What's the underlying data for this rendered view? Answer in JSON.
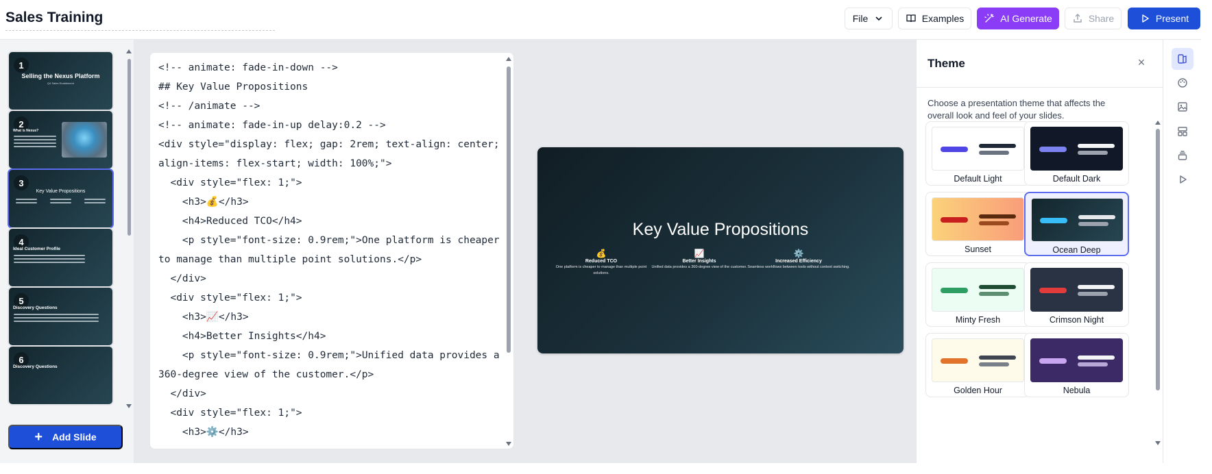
{
  "header": {
    "title": "Sales Training",
    "file_label": "File",
    "examples_label": "Examples",
    "ai_label": "AI Generate",
    "share_label": "Share",
    "present_label": "Present"
  },
  "sidebar": {
    "add_slide_label": "Add Slide",
    "slides": [
      {
        "num": "1",
        "title": "Selling the Nexus Platform",
        "subtitle": "Q4 Sales Enablement"
      },
      {
        "num": "2",
        "title": "What is Nexus?"
      },
      {
        "num": "3",
        "title": "Key Value Propositions"
      },
      {
        "num": "4",
        "title": "Ideal Customer Profile"
      },
      {
        "num": "5",
        "title": "Discovery Questions"
      },
      {
        "num": "6",
        "title": "Discovery Questions"
      }
    ]
  },
  "editor": {
    "code": "<!-- animate: fade-in-down -->\n## Key Value Propositions\n<!-- /animate -->\n<!-- animate: fade-in-up delay:0.2 -->\n<div style=\"display: flex; gap: 2rem; text-align: center; align-items: flex-start; width: 100%;\">\n  <div style=\"flex: 1;\">\n    <h3>💰</h3>\n    <h4>Reduced TCO</h4>\n    <p style=\"font-size: 0.9rem;\">One platform is cheaper to manage than multiple point solutions.</p>\n  </div>\n  <div style=\"flex: 1;\">\n    <h3>📈</h3>\n    <h4>Better Insights</h4>\n    <p style=\"font-size: 0.9rem;\">Unified data provides a 360-degree view of the customer.</p>\n  </div>\n  <div style=\"flex: 1;\">\n    <h3>⚙️</h3>"
  },
  "preview": {
    "title": "Key Value Propositions",
    "columns": [
      {
        "icon": "💰",
        "heading": "Reduced TCO",
        "text": "One platform is cheaper to manage than multiple point solutions."
      },
      {
        "icon": "📈",
        "heading": "Better Insights",
        "text": "Unified data provides a 360-degree view of the customer."
      },
      {
        "icon": "⚙️",
        "heading": "Increased Efficiency",
        "text": "Seamless workflows between tools without context switching."
      }
    ]
  },
  "theme_panel": {
    "title": "Theme",
    "description": "Choose a presentation theme that affects the overall look and feel of your slides.",
    "themes": [
      {
        "name": "Default Light",
        "bg": "#ffffff",
        "accent": "#5046e5",
        "line1": "#1f2937",
        "line2": "#6b7280"
      },
      {
        "name": "Default Dark",
        "bg": "#111827",
        "accent": "#7c83f0",
        "line1": "#f3f4f6",
        "line2": "#9ca3af"
      },
      {
        "name": "Sunset",
        "bg": "#fbc47a",
        "accent": "#c81e1e",
        "line1": "#5b2a0e",
        "line2": "#9a4a1e"
      },
      {
        "name": "Ocean Deep",
        "bg": "#1b313b",
        "accent": "#38bdf8",
        "line1": "#e5e7eb",
        "line2": "#9ca3af"
      },
      {
        "name": "Minty Fresh",
        "bg": "#ecfdf3",
        "accent": "#2f9e62",
        "line1": "#1e4d33",
        "line2": "#5e8f73"
      },
      {
        "name": "Crimson Night",
        "bg": "#2a3344",
        "accent": "#e23b3b",
        "line1": "#f3f4f6",
        "line2": "#9ca3af"
      },
      {
        "name": "Golden Hour",
        "bg": "#fffbeb",
        "accent": "#e2732b",
        "line1": "#3f4652",
        "line2": "#7a808a"
      },
      {
        "name": "Nebula",
        "bg": "#3b2a66",
        "accent": "#c9a7f0",
        "line1": "#f3f4f6",
        "line2": "#b8a9d8"
      }
    ],
    "selected": "Ocean Deep"
  },
  "colors": {
    "primary": "#1d4fd8",
    "ai_purple": "#8b3cf6",
    "selection": "#5b6cf0"
  },
  "rail_icons": [
    "layout-icon",
    "palette-icon",
    "image-icon",
    "template-icon",
    "layers-icon",
    "play-icon"
  ]
}
